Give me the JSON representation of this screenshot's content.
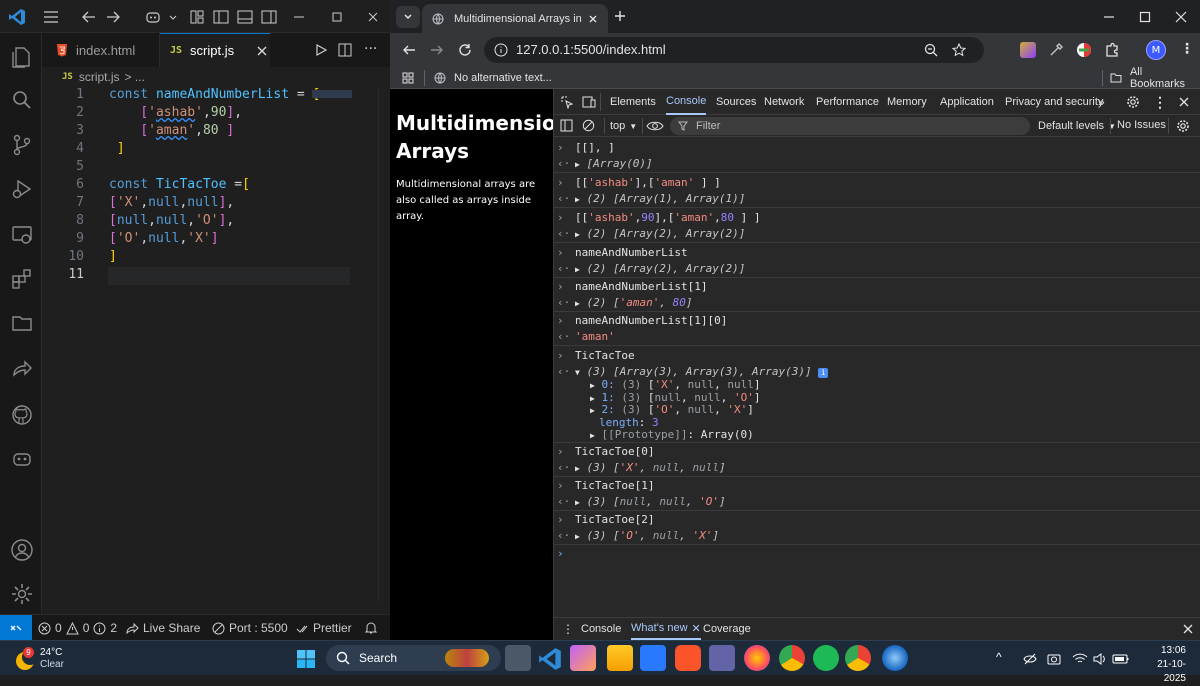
{
  "vscode": {
    "tabs": [
      {
        "label": "index.html",
        "active": false
      },
      {
        "label": "script.js",
        "active": true
      }
    ],
    "breadcrumb": {
      "file": "script.js",
      "rest": "> ..."
    },
    "code_lines": [
      {
        "n": "1"
      },
      {
        "n": "2"
      },
      {
        "n": "3"
      },
      {
        "n": "4"
      },
      {
        "n": "5"
      },
      {
        "n": "6"
      },
      {
        "n": "7"
      },
      {
        "n": "8"
      },
      {
        "n": "9"
      },
      {
        "n": "10"
      },
      {
        "n": "11"
      }
    ],
    "status": {
      "errors": "0",
      "warnings": "0",
      "info": "2",
      "live_share": "Live Share",
      "port": "Port : 5500",
      "prettier": "Prettier"
    }
  },
  "chrome": {
    "tab_title": "Multidimensional Arrays in Java",
    "url": "127.0.0.1:5500/index.html",
    "bookmark_item": "No alternative text...",
    "all_bookmarks": "All Bookmarks",
    "profile_initial": "M",
    "page": {
      "heading": "Multidimensional Arrays",
      "paragraph": "Multidimensional arrays are also called as arrays inside array."
    },
    "devtools": {
      "tabs": [
        "Elements",
        "Console",
        "Sources",
        "Network",
        "Performance",
        "Memory",
        "Application",
        "Privacy and security"
      ],
      "active_tab": "Console",
      "context": "top",
      "filter_placeholder": "Filter",
      "levels": "Default levels",
      "issues": "No Issues",
      "drawer_tabs": [
        "Console",
        "What's new",
        "Coverage"
      ]
    }
  },
  "taskbar": {
    "temperature": "24°C",
    "weather": "Clear",
    "weather_badge": "9",
    "search": "Search",
    "time": "13:06",
    "date": "21-10-2025"
  },
  "colors": {
    "vscode_bg": "#1f1f1f",
    "accent_blue": "#0078d4",
    "chrome_toolbar": "#35363a",
    "devtools_bg": "#282828",
    "taskbar_bg": "#1c2a3a"
  }
}
